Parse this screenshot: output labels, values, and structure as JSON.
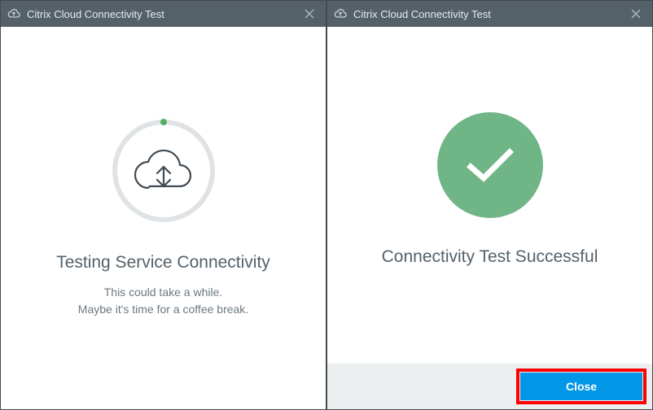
{
  "left": {
    "title": "Citrix Cloud Connectivity Test",
    "icon_name": "cloud-upload-icon",
    "headline": "Testing Service Connectivity",
    "sub1": "This could take a while.",
    "sub2": "Maybe it's time for a coffee break.",
    "spinner_dot_color": "#4fb064",
    "spinner_ring_color": "#e0e3e5"
  },
  "right": {
    "title": "Citrix Cloud Connectivity Test",
    "icon_name": "cloud-upload-icon",
    "headline": "Connectivity Test Successful",
    "success_color": "#6fb585",
    "close_button": "Close"
  },
  "colors": {
    "titlebar_bg": "#546169",
    "titlebar_fg": "#e6eaec",
    "primary_button": "#0296e6",
    "highlight": "#ff0000",
    "text_primary": "#53616a",
    "text_secondary": "#6b7880",
    "footer_bg": "#eceff0"
  }
}
